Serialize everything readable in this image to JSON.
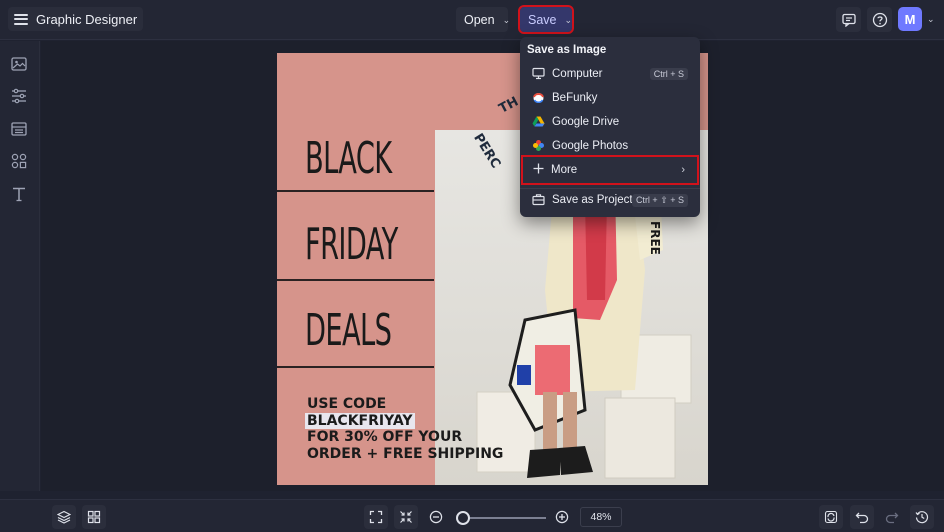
{
  "app": {
    "title": "Graphic Designer"
  },
  "header": {
    "open_label": "Open",
    "save_label": "Save",
    "avatar_initial": "M"
  },
  "save_menu": {
    "heading": "Save as Image",
    "items": [
      {
        "label": "Computer",
        "shortcut": "Ctrl + S",
        "icon": "monitor-icon"
      },
      {
        "label": "BeFunky",
        "shortcut": "",
        "icon": "befunky-icon"
      },
      {
        "label": "Google Drive",
        "shortcut": "",
        "icon": "google-drive-icon"
      },
      {
        "label": "Google Photos",
        "shortcut": "",
        "icon": "google-photos-icon"
      },
      {
        "label": "More",
        "shortcut": "",
        "icon": "plus-icon"
      }
    ],
    "project": {
      "label": "Save as Project",
      "shortcut": "Ctrl + ⇧ + S",
      "icon": "briefcase-icon"
    }
  },
  "poster": {
    "words": [
      "BLACK",
      "FRIDAY",
      "DEALS"
    ],
    "promo_lines": [
      "USE CODE",
      "BLACKFRIYAY",
      "FOR 30% OFF YOUR",
      "ORDER + FREE SHIPPING"
    ],
    "arc_fragments": [
      "TH",
      "PERC"
    ],
    "side_text": "FREE",
    "background_color": "#d6948b"
  },
  "zoom": {
    "percent": "48%",
    "level": 0.12
  },
  "colors": {
    "accent": "#6f79ff",
    "highlight": "#d1121b"
  }
}
